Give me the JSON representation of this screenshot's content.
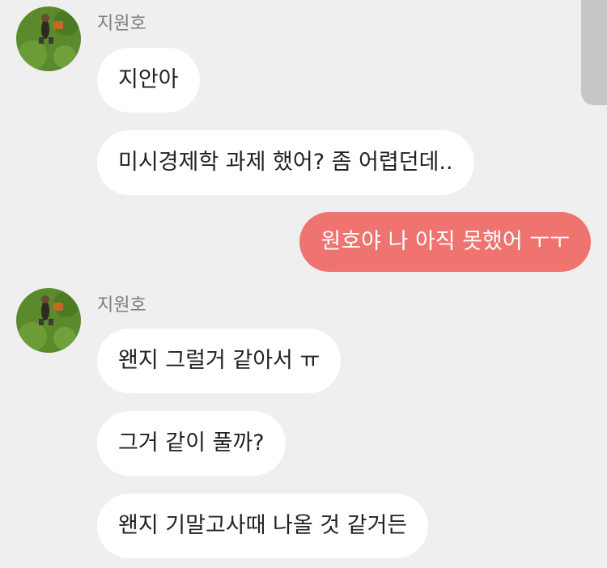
{
  "colors": {
    "background": "#efefef",
    "incoming_bubble": "#ffffff",
    "outgoing_bubble": "#ef736f",
    "sender_name": "#7d7d7d",
    "scrollbar": "#c6c6c6"
  },
  "groups": [
    {
      "sender": "지원호",
      "avatar_icon": "grass-photo-avatar",
      "messages": [
        "지안아",
        "미시경제학 과제 했어? 좀 어렵던데.."
      ]
    },
    {
      "sender": "me",
      "messages": [
        "원호야 나 아직 못했어 ㅜㅜ"
      ]
    },
    {
      "sender": "지원호",
      "avatar_icon": "grass-photo-avatar",
      "messages": [
        "왠지 그럴거 같아서 ㅠ",
        "그거 같이 풀까?",
        "왠지 기말고사때 나올 것 같거든"
      ]
    }
  ]
}
